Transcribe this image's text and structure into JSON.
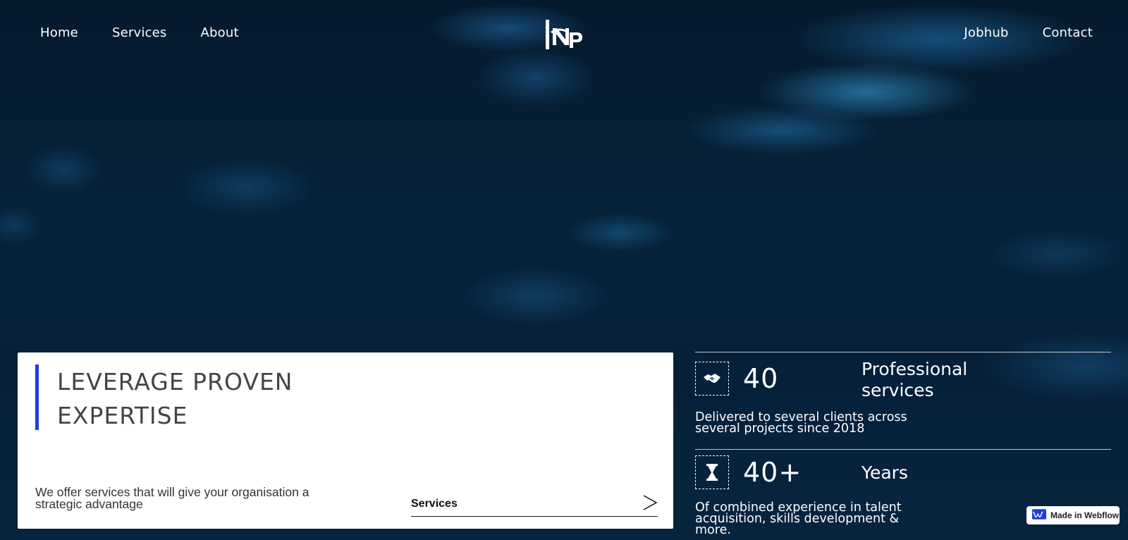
{
  "nav": {
    "left": [
      {
        "label": "Home"
      },
      {
        "label": "Services"
      },
      {
        "label": "About"
      }
    ],
    "right": [
      {
        "label": "Jobhub"
      },
      {
        "label": "Contact"
      }
    ],
    "logo_icon": "knp-logo-icon"
  },
  "hero": {
    "title": "LEVERAGE PROVEN EXPERTISE",
    "text": "We offer services that will give your organisation a strategic advantage",
    "link_label": "Services",
    "link_icon": "arrow-right-icon",
    "accent_color": "#1e3fe0"
  },
  "stats": [
    {
      "icon": "handshake-icon",
      "number": "40",
      "label": "Professional services",
      "desc": "Delivered to several clients across several projects since 2018"
    },
    {
      "icon": "hourglass-icon",
      "number": "40+",
      "label": "Years",
      "desc": "Of combined experience in talent acquisition, skills development & more."
    }
  ],
  "badge": {
    "label": "Made in Webflow",
    "icon": "webflow-icon"
  }
}
